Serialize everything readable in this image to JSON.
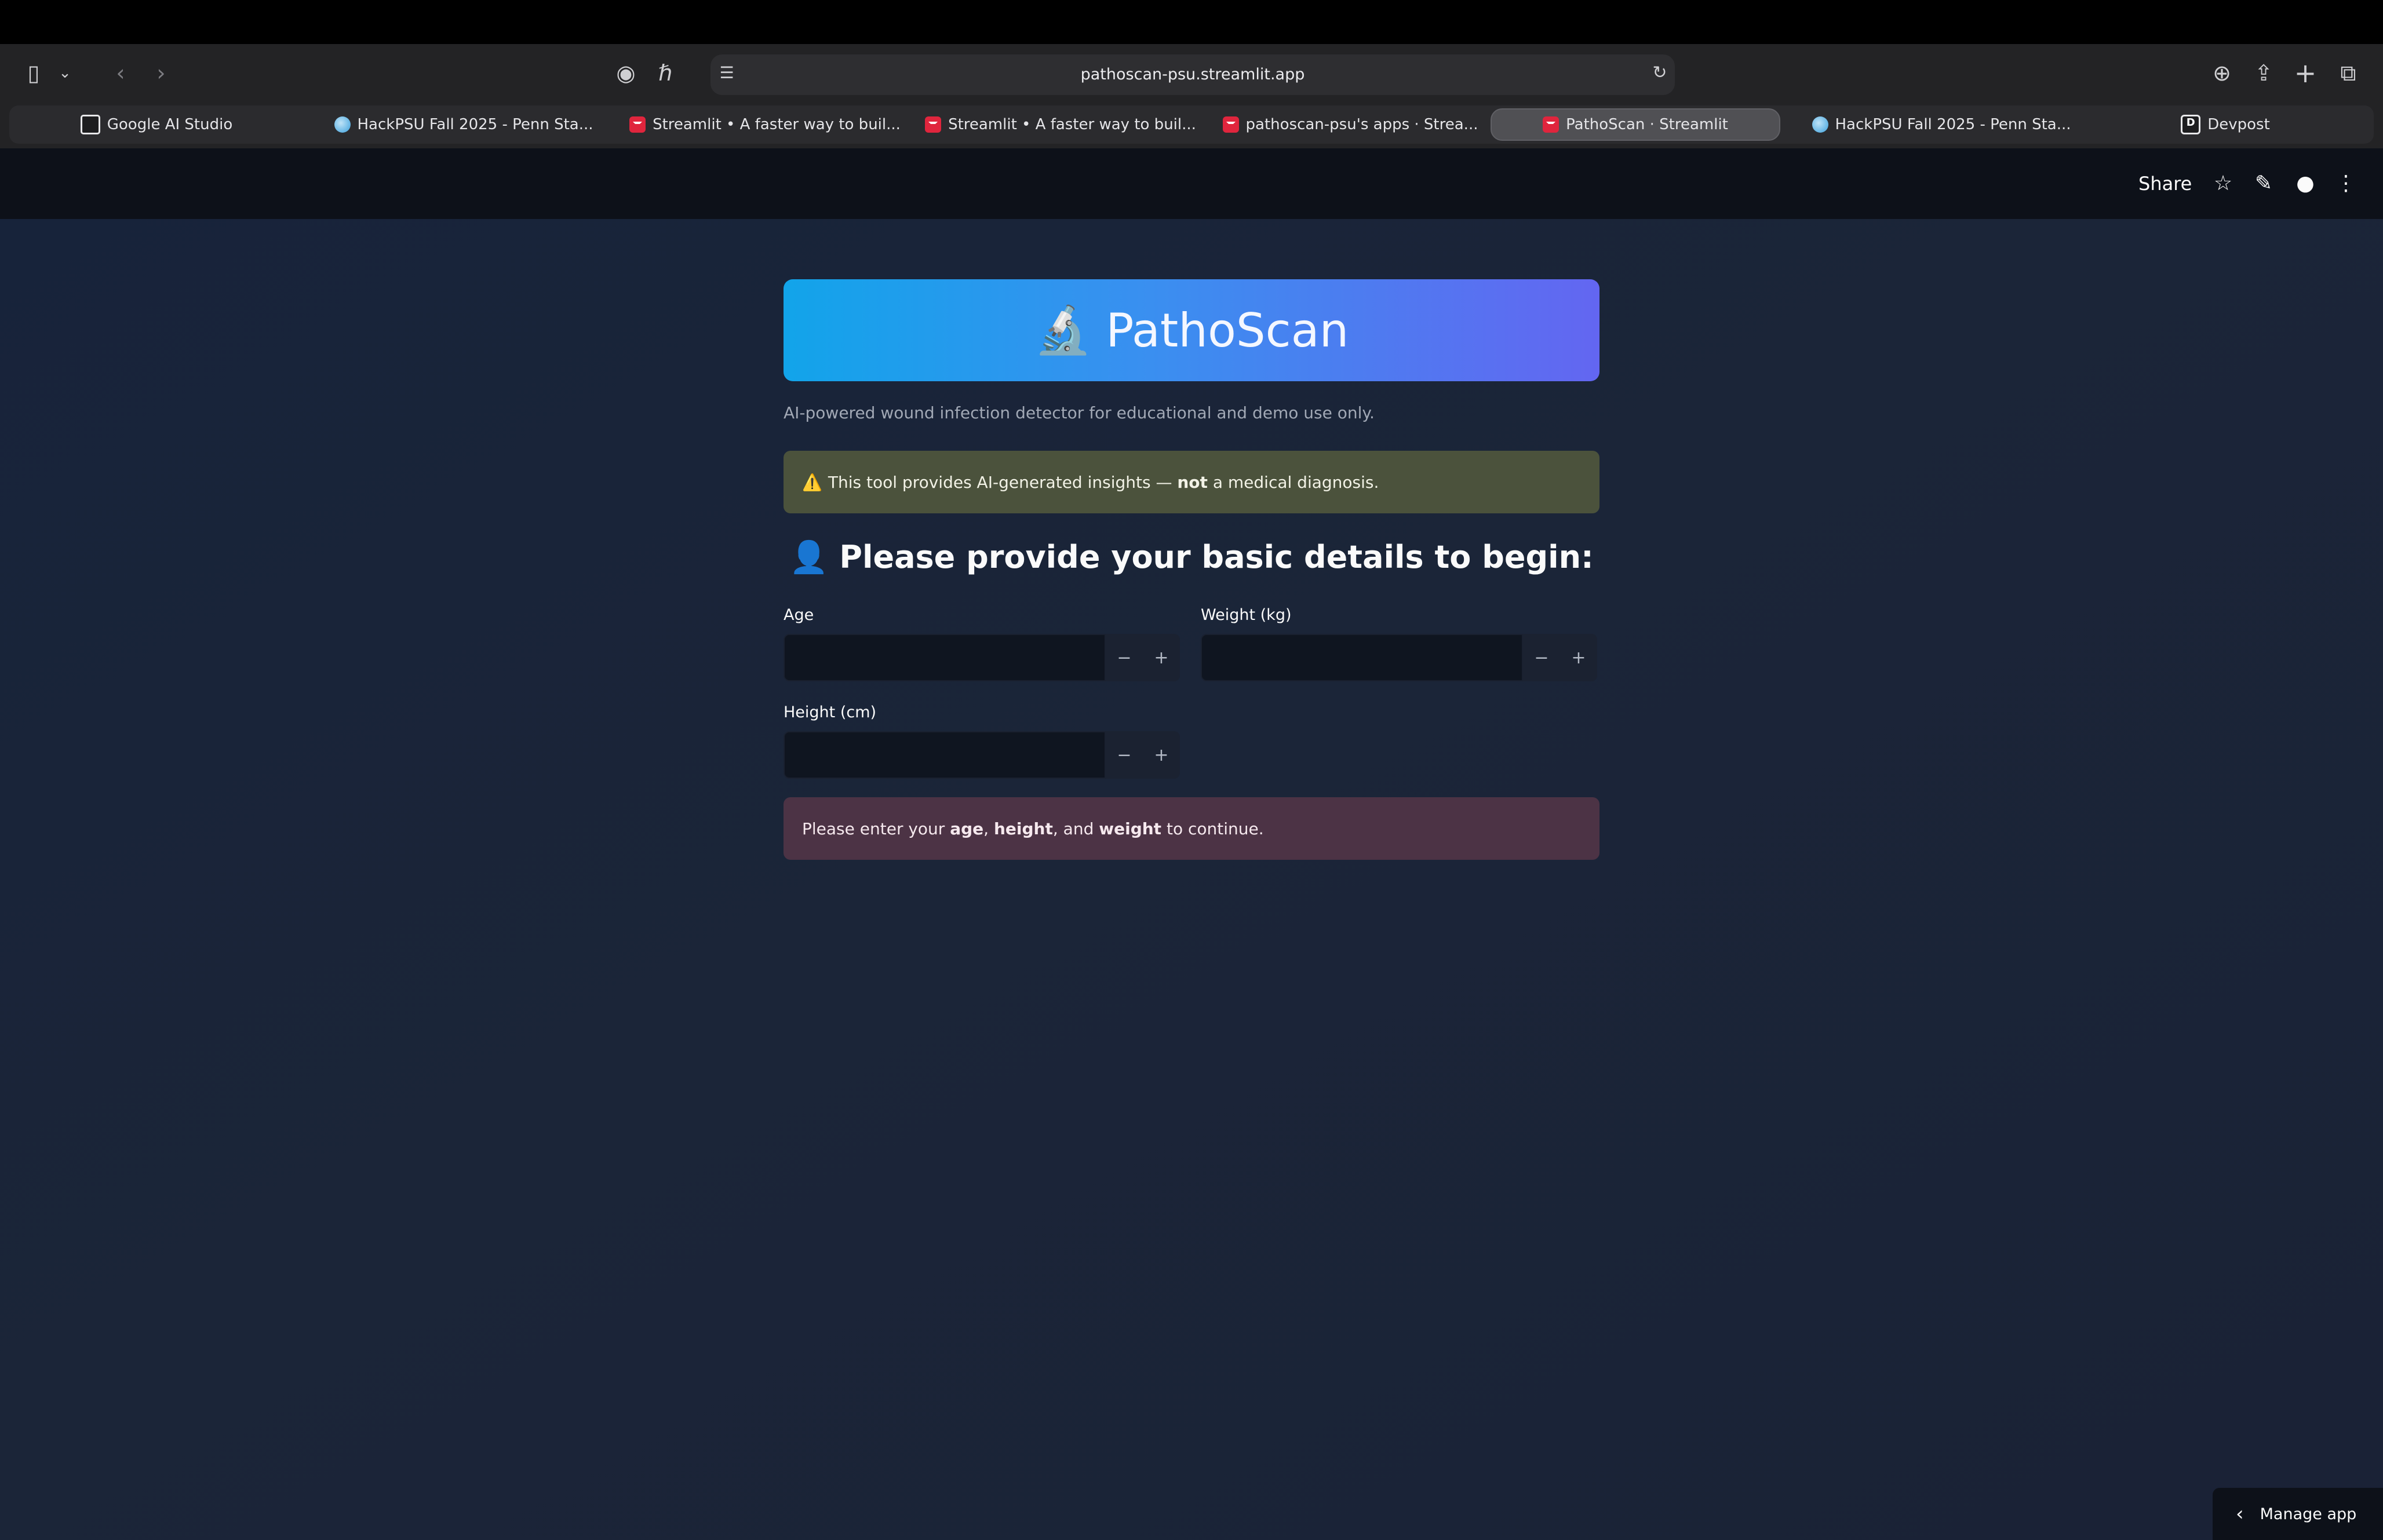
{
  "browser": {
    "url": "pathoscan-psu.streamlit.app",
    "tabs": [
      {
        "label": "Google AI Studio",
        "favicon": "google-ai-studio-icon"
      },
      {
        "label": "HackPSU Fall 2025 - Penn Sta...",
        "favicon": "hackpsu-icon"
      },
      {
        "label": "Streamlit • A faster way to buil...",
        "favicon": "streamlit-icon"
      },
      {
        "label": "Streamlit • A faster way to buil...",
        "favicon": "streamlit-icon"
      },
      {
        "label": "pathoscan-psu's apps · Strea...",
        "favicon": "streamlit-icon"
      },
      {
        "label": "PathoScan · Streamlit",
        "favicon": "streamlit-icon",
        "active": true
      },
      {
        "label": "HackPSU Fall 2025 - Penn Sta...",
        "favicon": "hackpsu-icon"
      },
      {
        "label": "Devpost",
        "favicon": "devpost-icon"
      }
    ],
    "devpost_letter": "D"
  },
  "header": {
    "share_label": "Share",
    "icons": [
      "star-icon",
      "edit-icon",
      "github-icon",
      "more-vertical-icon"
    ]
  },
  "app": {
    "title_emoji": "🔬",
    "title": "PathoScan",
    "subtitle": "AI-powered wound infection detector for educational and demo use only.",
    "warning": {
      "icon": "⚠️",
      "text_before": "This tool provides AI-generated insights — ",
      "bold": "not",
      "text_after": " a medical diagnosis."
    },
    "details_heading_emoji": "👤",
    "details_heading": "Please provide your basic details to begin:",
    "fields": {
      "age": {
        "label": "Age",
        "value": ""
      },
      "weight": {
        "label": "Weight (kg)",
        "value": ""
      },
      "height": {
        "label": "Height (cm)",
        "value": ""
      }
    },
    "stepper": {
      "minus": "−",
      "plus": "+"
    },
    "error": {
      "t1": "Please enter your ",
      "b1": "age",
      "t2": ", ",
      "b2": "height",
      "t3": ", and ",
      "b3": "weight",
      "t4": " to continue."
    }
  },
  "footer": {
    "manage_label": "Manage app"
  },
  "colors": {
    "title_gradient_start": "#12a4ea",
    "title_gradient_end": "#6366f1",
    "warning_bg": "#4b523c",
    "error_bg": "#4c3345",
    "app_bg": "#1a2236"
  }
}
